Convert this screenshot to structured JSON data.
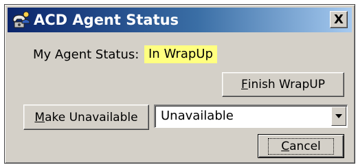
{
  "window": {
    "title": "ACD Agent Status",
    "icon": "agent-phone-icon",
    "close_label": "X"
  },
  "status": {
    "label": "My Agent Status:",
    "value": "In WrapUp",
    "highlight_color": "#ffff80"
  },
  "buttons": {
    "finish_mnemonic": "F",
    "finish_rest": "inish WrapUP",
    "unavailable_mnemonic": "M",
    "unavailable_rest": "ake Unavailable",
    "cancel_mnemonic": "C",
    "cancel_rest": "ancel"
  },
  "availability_select": {
    "selected": "Unavailable"
  },
  "colors": {
    "face": "#d4d0c8",
    "title_gradient_start": "#0a246a",
    "title_gradient_end": "#a6caf0"
  }
}
